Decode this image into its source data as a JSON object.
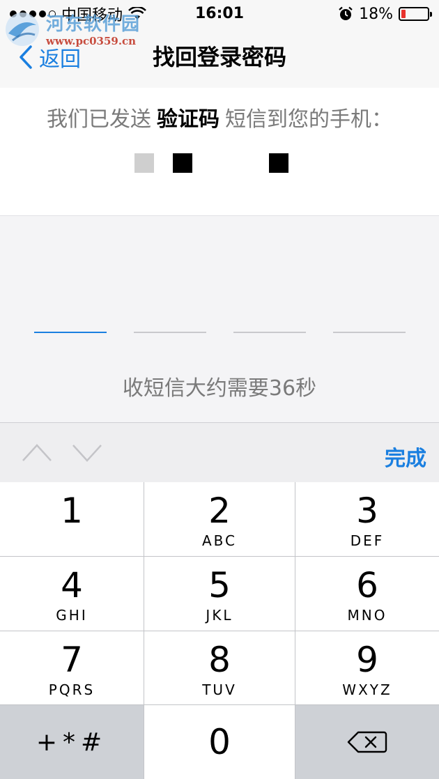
{
  "status_bar": {
    "carrier": "中国移动",
    "time": "16:01",
    "battery_percent": "18%",
    "battery_level": 0.18,
    "battery_color": "#e8322d"
  },
  "watermark": {
    "name": "河东软件园",
    "url": "www.pc0359.cn"
  },
  "nav": {
    "back_label": "返回",
    "title": "找回登录密码"
  },
  "info": {
    "prefix": "我们已发送",
    "highlight": "验证码",
    "suffix": "短信到您的手机："
  },
  "code_entry": {
    "slots": 4,
    "active_slot": 0,
    "countdown": "收短信大约需要36秒"
  },
  "toolbar": {
    "prev_icon": "chevron-up-icon",
    "next_icon": "chevron-down-icon",
    "done_label": "完成"
  },
  "keypad": {
    "keys": [
      {
        "num": "1",
        "letters": ""
      },
      {
        "num": "2",
        "letters": "ABC"
      },
      {
        "num": "3",
        "letters": "DEF"
      },
      {
        "num": "4",
        "letters": "GHI"
      },
      {
        "num": "5",
        "letters": "JKL"
      },
      {
        "num": "6",
        "letters": "MNO"
      },
      {
        "num": "7",
        "letters": "PQRS"
      },
      {
        "num": "8",
        "letters": "TUV"
      },
      {
        "num": "9",
        "letters": "WXYZ"
      },
      {
        "num": "0",
        "letters": ""
      }
    ],
    "symbols_label": "+*#",
    "delete_icon": "backspace-icon"
  },
  "colors": {
    "accent": "#1a7fe0",
    "muted_text": "#7a7a7a"
  }
}
